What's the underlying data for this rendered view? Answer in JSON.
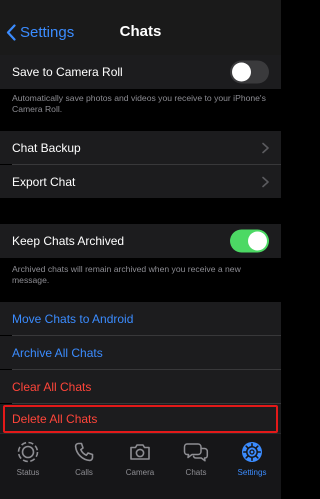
{
  "nav": {
    "back_label": "Settings",
    "title": "Chats"
  },
  "save_section": {
    "label": "Save to Camera Roll",
    "toggle_state": "off",
    "footnote": "Automatically save photos and videos you receive to your iPhone's Camera Roll."
  },
  "backup_section": {
    "items": [
      {
        "label": "Chat Backup"
      },
      {
        "label": "Export Chat"
      }
    ]
  },
  "archive_section": {
    "label": "Keep Chats Archived",
    "toggle_state": "on",
    "footnote": "Archived chats will remain archived when you receive a new message."
  },
  "actions": [
    {
      "label": "Move Chats to Android",
      "color": "#3b8cff"
    },
    {
      "label": "Archive All Chats",
      "color": "#3b8cff"
    },
    {
      "label": "Clear All Chats",
      "color": "#ff453a"
    },
    {
      "label": "Delete All Chats",
      "color": "#ff453a"
    }
  ],
  "tabbar": {
    "tabs": [
      {
        "label": "Status",
        "icon": "status-icon",
        "active": false
      },
      {
        "label": "Calls",
        "icon": "phone-icon",
        "active": false
      },
      {
        "label": "Camera",
        "icon": "camera-icon",
        "active": false
      },
      {
        "label": "Chats",
        "icon": "chat-bubbles-icon",
        "active": false
      },
      {
        "label": "Settings",
        "icon": "gear-icon",
        "active": true
      }
    ]
  },
  "colors": {
    "accent": "#3b8cff",
    "destructive": "#ff453a",
    "toggle_on": "#4cd964",
    "highlight_border": "#e31919"
  }
}
